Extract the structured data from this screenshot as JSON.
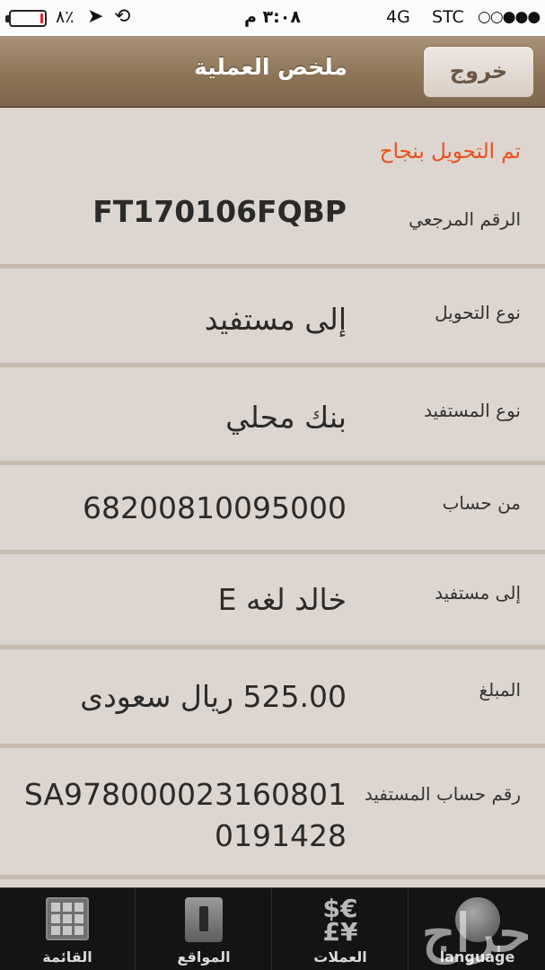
{
  "status_bar": {
    "battery_pct": "٨٪",
    "battery_level": 0.08,
    "time": "٣:٠٨ م",
    "network": "4G",
    "carrier": "STC",
    "signal": "○○●●●",
    "location_glyph": "➤",
    "lock_glyph": "⟲"
  },
  "nav": {
    "title": "ملخص العملية",
    "exit_label": "خروج"
  },
  "success_message": "تم التحويل بنجاح",
  "fields": [
    {
      "label": "الرقم المرجعي",
      "value": "FT170106FQBP"
    },
    {
      "label": "نوع التحويل",
      "value": "إلى مستفيد"
    },
    {
      "label": "نوع المستفيد",
      "value": "بنك محلي"
    },
    {
      "label": "من حساب",
      "value": "68200810095000"
    },
    {
      "label": "إلى مستفيد",
      "value": "خالد لغه E"
    },
    {
      "label": "المبلغ",
      "value": "525.00 ريال سعودى"
    },
    {
      "label": "رقم حساب المستفيد",
      "value": "SA978000023160801 0191428"
    }
  ],
  "tabs": [
    {
      "label": "القائمة",
      "icon": "grid-icon"
    },
    {
      "label": "المواقع",
      "icon": "map-icon"
    },
    {
      "label": "العملات",
      "icon": "currency-icon",
      "glyph": "$€\n£¥"
    },
    {
      "label": "language",
      "icon": "globe-icon"
    }
  ],
  "watermark": "حراج",
  "colors": {
    "nav_bg": "#8d7558",
    "content_bg": "#ddd5cf",
    "success": "#ea4f1c",
    "tabbar_bg": "#141414"
  }
}
